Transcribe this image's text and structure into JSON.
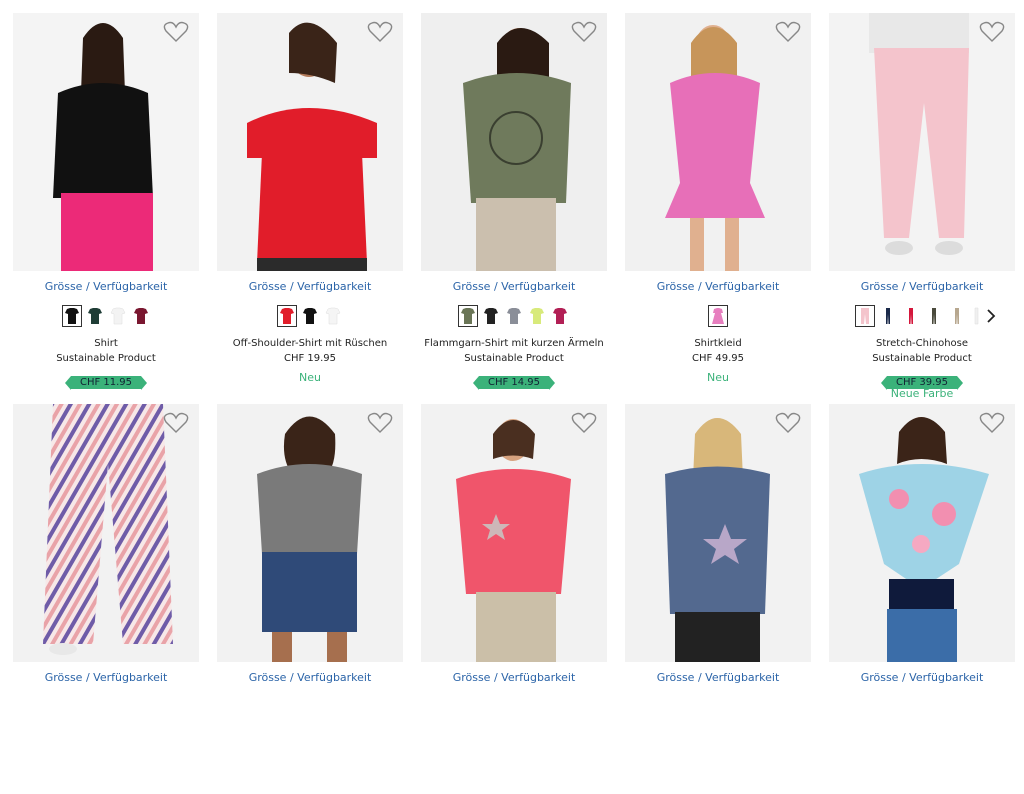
{
  "products": [
    {
      "size_link": "Grösse / Verfügbarkeit",
      "title": "Shirt",
      "subtitle": "Sustainable Product",
      "price": "CHF 11.95",
      "price_style": "badge",
      "tag": "",
      "swatches": [
        "#111111",
        "#1f3d36",
        "#f3f3f3",
        "#7a1730"
      ],
      "selected": 0,
      "img_colors": [
        "#f4f4f4",
        "#111111",
        "#ec2a78"
      ]
    },
    {
      "size_link": "Grösse / Verfügbarkeit",
      "title": "Off-Shoulder-Shirt mit Rüschen",
      "subtitle": "",
      "price": "CHF 19.95",
      "price_style": "plain",
      "tag": "Neu",
      "swatches": [
        "#e11d2a",
        "#111111",
        "#f5f5f5"
      ],
      "selected": 0,
      "img_colors": [
        "#f2f2f2",
        "#e11d2a",
        "#2b2b2b"
      ]
    },
    {
      "size_link": "Grösse / Verfügbarkeit",
      "title": "Flammgarn-Shirt mit kurzen Ärmeln",
      "subtitle": "Sustainable Product",
      "price": "CHF 14.95",
      "price_style": "badge",
      "tag": "",
      "swatches": [
        "#6a7556",
        "#222222",
        "#8a8e98",
        "#d8ea7b",
        "#b21f55"
      ],
      "selected": 0,
      "img_colors": [
        "#efefef",
        "#6f7a5c",
        "#cbbfae"
      ]
    },
    {
      "size_link": "Grösse / Verfügbarkeit",
      "title": "Shirtkleid",
      "subtitle": "",
      "price": "CHF 49.95",
      "price_style": "plain",
      "tag": "Neu",
      "swatches": [
        "#e77fbf"
      ],
      "selected": 0,
      "img_colors": [
        "#f1f1f1",
        "#e76fb8",
        "#f4e8ee"
      ]
    },
    {
      "size_link": "Grösse / Verfügbarkeit",
      "title": "Stretch-Chinohose",
      "subtitle": "Sustainable Product",
      "price": "CHF 39.95",
      "price_style": "badge",
      "tag": "Neue Farbe",
      "swatches": [
        "#f4c4cc",
        "#1b2a4a",
        "#d4173c",
        "#4a4a3c",
        "#b7a78f",
        "#f0f0f0"
      ],
      "selected": 0,
      "img_colors": [
        "#f3f3f3",
        "#f4c4cc",
        "#e8e8e8"
      ]
    },
    {
      "size_link": "Grösse / Verfügbarkeit",
      "img_colors": [
        "#f2f2f2",
        "#6f5ca8",
        "#e9a3a8"
      ]
    },
    {
      "size_link": "Grösse / Verfügbarkeit",
      "img_colors": [
        "#f2f2f2",
        "#7a7a7a",
        "#2f4a78"
      ]
    },
    {
      "size_link": "Grösse / Verfügbarkeit",
      "img_colors": [
        "#f2f2f2",
        "#f0556b",
        "#cbbfa8"
      ]
    },
    {
      "size_link": "Grösse / Verfügbarkeit",
      "img_colors": [
        "#f2f2f2",
        "#53698f",
        "#222222"
      ]
    },
    {
      "size_link": "Grösse / Verfügbarkeit",
      "img_colors": [
        "#f2f2f2",
        "#2d87c0",
        "#0f1a3b"
      ]
    }
  ]
}
